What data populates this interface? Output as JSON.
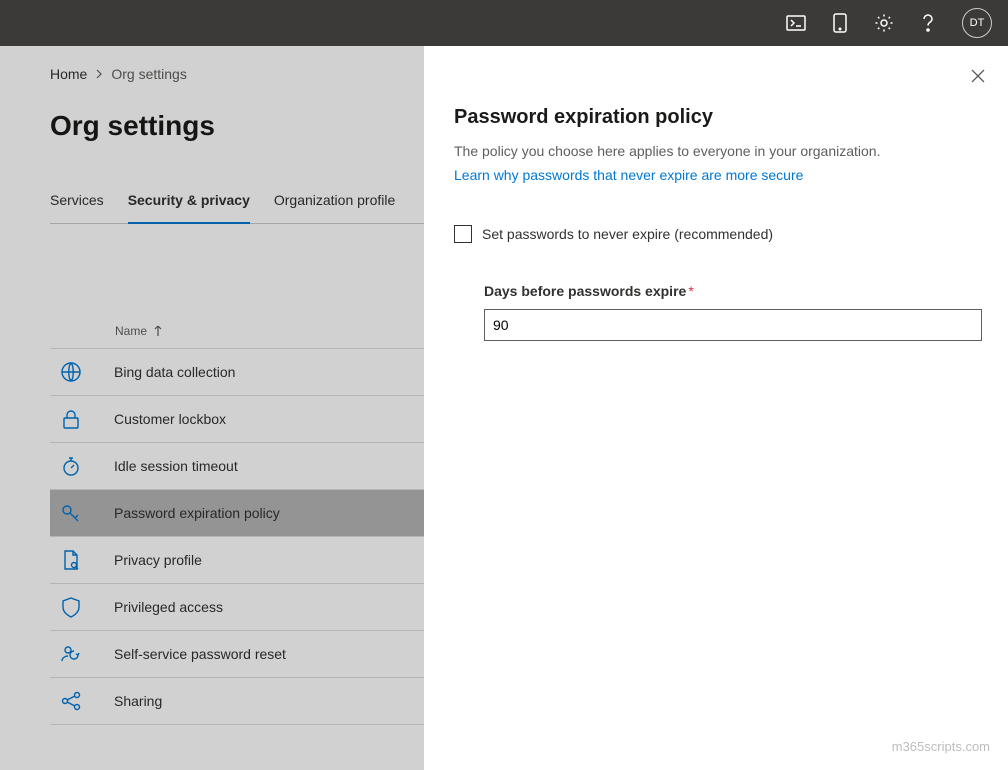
{
  "topbar": {
    "avatar_initials": "DT"
  },
  "breadcrumb": {
    "home": "Home",
    "current": "Org settings"
  },
  "page_title": "Org settings",
  "tabs": {
    "services": "Services",
    "security": "Security & privacy",
    "org_profile": "Organization profile"
  },
  "column_header": "Name",
  "rows": {
    "bing": "Bing data collection",
    "lockbox": "Customer lockbox",
    "idle": "Idle session timeout",
    "password_exp": "Password expiration policy",
    "privacy": "Privacy profile",
    "privileged": "Privileged access",
    "sspr": "Self-service password reset",
    "sharing": "Sharing"
  },
  "panel": {
    "title": "Password expiration policy",
    "description": "The policy you choose here applies to everyone in your organization.",
    "link": "Learn why passwords that never expire are more secure",
    "checkbox_label": "Set passwords to never expire (recommended)",
    "days_label": "Days before passwords expire",
    "days_value": "90"
  },
  "watermark": "m365scripts.com"
}
